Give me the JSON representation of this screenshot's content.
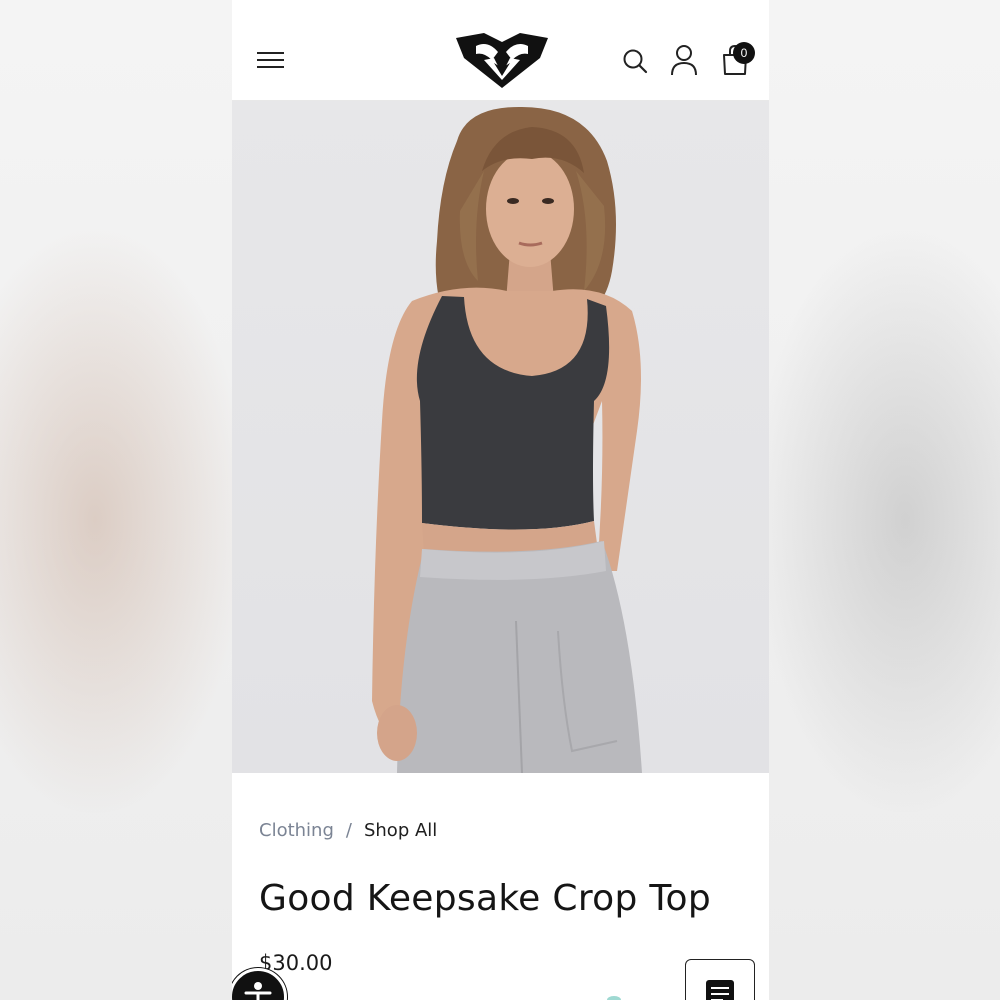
{
  "header": {
    "menu_icon": "hamburger-menu-icon",
    "logo": "roxy-heart-logo",
    "search_icon": "search-icon",
    "account_icon": "user-icon",
    "bag_icon": "shopping-bag-icon",
    "bag_count": "0"
  },
  "breadcrumb": {
    "parent": "Clothing",
    "separator": "/",
    "current": "Shop All"
  },
  "product": {
    "title": "Good Keepsake Crop Top",
    "price": "$30.00",
    "image_icon": "product-photo-model-crop-top"
  },
  "widgets": {
    "accessibility_icon": "accessibility-icon",
    "chat_icon": "chat-list-icon"
  },
  "colors": {
    "accent": "#111111",
    "breadcrumb_link": "#7b8494",
    "photo_background": "#e5e5e8"
  }
}
